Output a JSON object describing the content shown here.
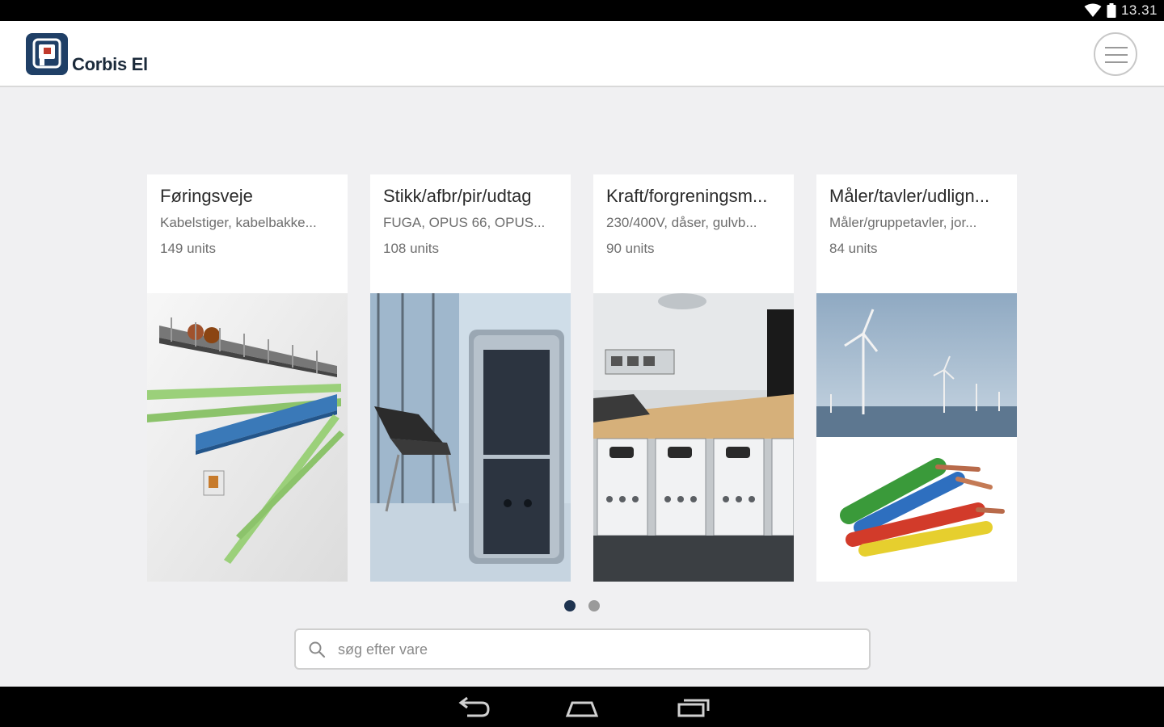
{
  "status_bar": {
    "time": "13.31",
    "icons": [
      "wifi-icon",
      "battery-icon"
    ]
  },
  "header": {
    "app_title": "Corbis El",
    "logo_icon": "corbis-logo",
    "menu_icon": "hamburger-menu-icon"
  },
  "categories": [
    {
      "title": "Føringsveje",
      "subtitle": "Kabelstiger, kabelbakke...",
      "count": "149 units",
      "image": "cable-trays-image"
    },
    {
      "title": "Stikk/afbr/pir/udtag",
      "subtitle": "FUGA, OPUS 66, OPUS...",
      "count": "108 units",
      "image": "wall-switch-socket-image"
    },
    {
      "title": "Kraft/forgreningsm...",
      "subtitle": "230/400V, dåser, gulvb...",
      "count": "90 units",
      "image": "motor-protection-switches-image"
    },
    {
      "title": "Måler/tavler/udlign...",
      "subtitle": "Måler/gruppetavler, jor...",
      "count": "84 units",
      "image": "wind-turbines-and-cables-image"
    }
  ],
  "pager": {
    "pages": 2,
    "active": 1
  },
  "search": {
    "placeholder": "søg efter vare",
    "value": ""
  },
  "nav_bar": {
    "buttons": [
      "back-icon",
      "home-icon",
      "recent-apps-icon"
    ]
  },
  "colors": {
    "header_bg": "#ffffff",
    "page_bg": "#f0f0f2",
    "logo_bg": "#1f3f66",
    "active_dot": "#1e3350",
    "inactive_dot": "#9a9a9a",
    "system_bars": "#000000"
  }
}
